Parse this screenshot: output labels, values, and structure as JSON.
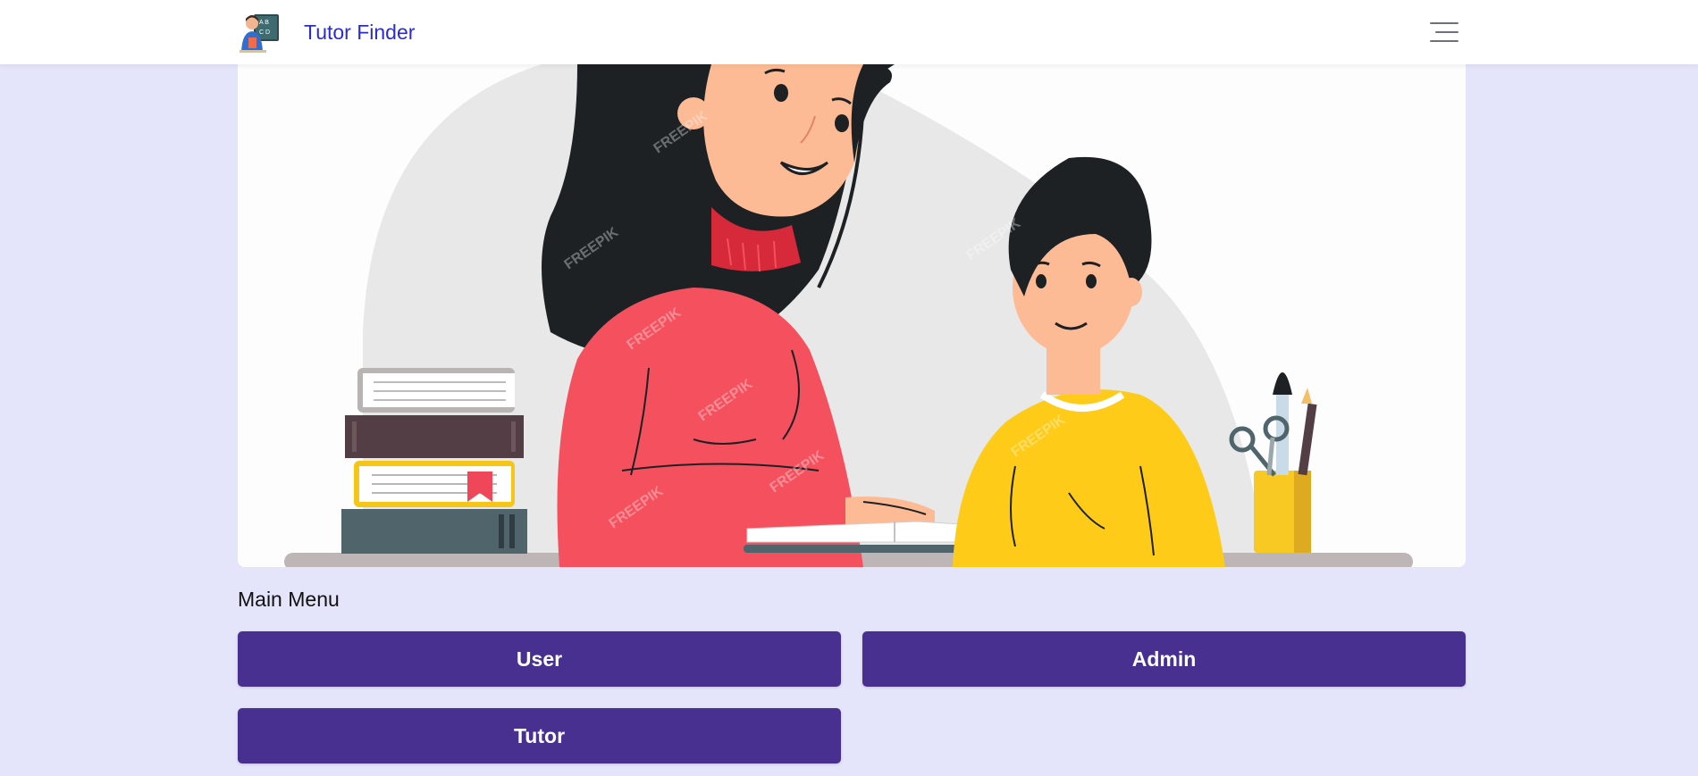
{
  "navbar": {
    "brand_title": "Tutor Finder",
    "logo_icon": "teacher-at-chalkboard-icon",
    "menu_icon": "hamburger-menu-icon"
  },
  "hero": {
    "illustration": "teacher-helping-student-reading-illustration",
    "watermark": "FREEPIK"
  },
  "main_menu": {
    "heading": "Main Menu",
    "buttons": [
      {
        "label": "User"
      },
      {
        "label": "Admin"
      },
      {
        "label": "Tutor"
      }
    ]
  },
  "colors": {
    "page_bg": "#e4e5fb",
    "brand_text": "#2b2bd3",
    "button_bg": "#47308f",
    "button_text": "#ffffff"
  }
}
